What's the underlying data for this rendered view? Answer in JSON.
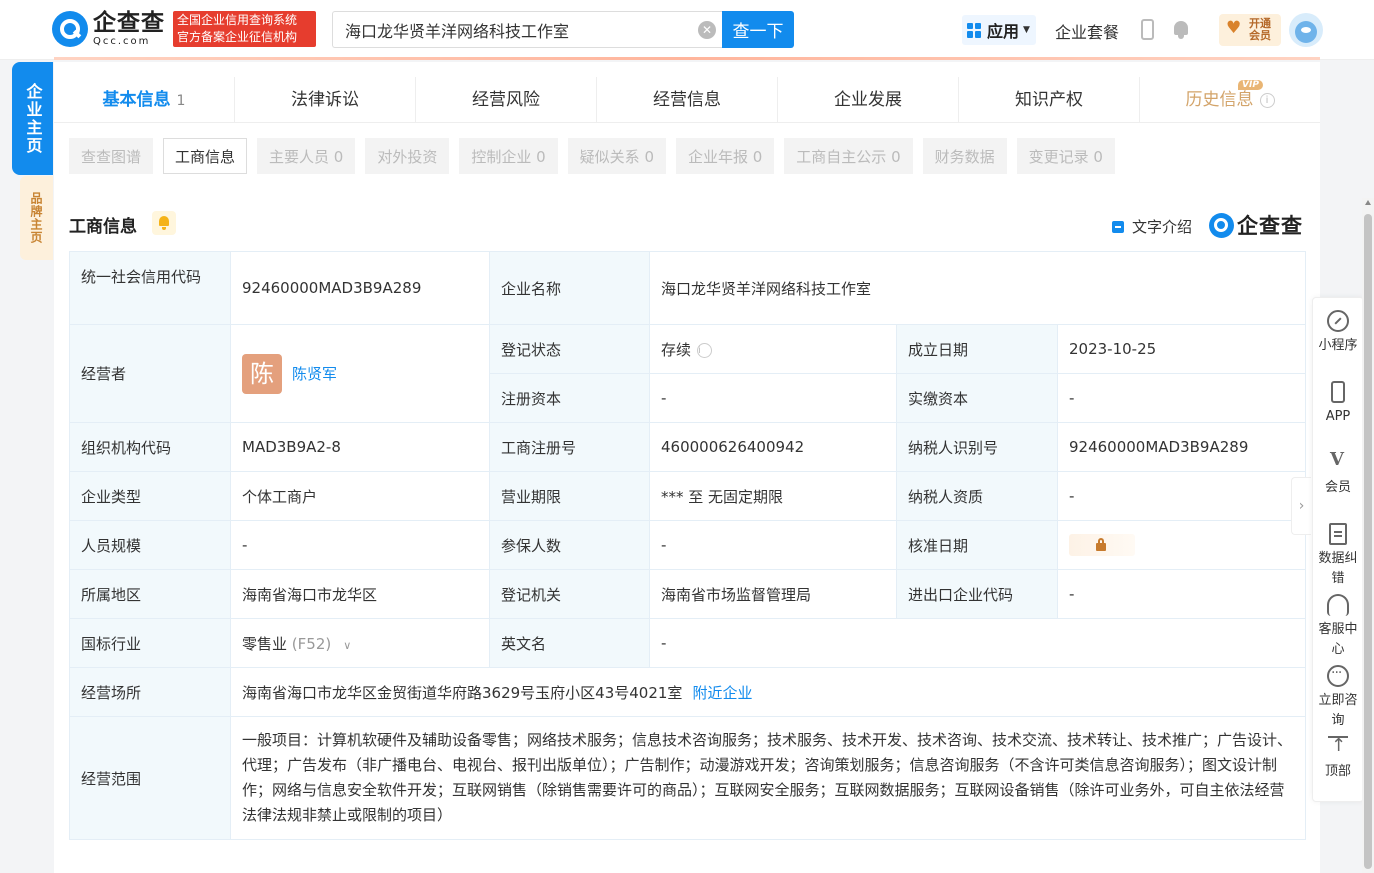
{
  "header": {
    "logo_cn": "企查查",
    "logo_en": "Qcc.com",
    "badge_line1": "全国企业信用查询系统",
    "badge_line2": "官方备案企业征信机构",
    "search_value": "海口龙华贤羊洋网络科技工作室",
    "search_button": "查一下",
    "app_label": "应用",
    "package_label": "企业套餐",
    "vip_line1": "开通",
    "vip_line2": "会员"
  },
  "side_tags": {
    "main": "企业主页",
    "brand": "品牌主页"
  },
  "tabs": [
    {
      "label": "基本信息",
      "count": "1"
    },
    {
      "label": "法律诉讼"
    },
    {
      "label": "经营风险"
    },
    {
      "label": "经营信息"
    },
    {
      "label": "企业发展"
    },
    {
      "label": "知识产权"
    },
    {
      "label": "历史信息",
      "tag": "VIP"
    }
  ],
  "chips": [
    "查查图谱",
    "工商信息",
    "主要人员 0",
    "对外投资",
    "控制企业 0",
    "疑似关系 0",
    "企业年报 0",
    "工商自主公示 0",
    "财务数据",
    "变更记录 0"
  ],
  "section": {
    "title": "工商信息",
    "text_intro": "文字介绍",
    "brand": "企查查"
  },
  "info": {
    "credit_code_label": "统一社会信用代码",
    "credit_code": "92460000MAD3B9A289",
    "company_name_label": "企业名称",
    "company_name": "海口龙华贤羊洋网络科技工作室",
    "operator_label": "经营者",
    "operator_avatar": "陈",
    "operator_name": "陈贤军",
    "status_label": "登记状态",
    "status": "存续",
    "founded_label": "成立日期",
    "founded": "2023-10-25",
    "reg_capital_label": "注册资本",
    "reg_capital": "-",
    "paid_capital_label": "实缴资本",
    "paid_capital": "-",
    "org_code_label": "组织机构代码",
    "org_code": "MAD3B9A2-8",
    "reg_no_label": "工商注册号",
    "reg_no": "460000626400942",
    "taxpayer_id_label": "纳税人识别号",
    "taxpayer_id": "92460000MAD3B9A289",
    "type_label": "企业类型",
    "type": "个体工商户",
    "term_label": "营业期限",
    "term": "*** 至 无固定期限",
    "taxpayer_qual_label": "纳税人资质",
    "taxpayer_qual": "-",
    "staff_size_label": "人员规模",
    "staff_size": "-",
    "insured_label": "参保人数",
    "insured": "-",
    "approval_date_label": "核准日期",
    "region_label": "所属地区",
    "region": "海南省海口市龙华区",
    "authority_label": "登记机关",
    "authority": "海南省市场监督管理局",
    "import_export_label": "进出口企业代码",
    "import_export": "-",
    "industry_label": "国标行业",
    "industry": "零售业",
    "industry_code": "(F52)",
    "english_name_label": "英文名",
    "english_name": "-",
    "address_label": "经营场所",
    "address": "海南省海口市龙华区金贸街道华府路3629号玉府小区43号4021室",
    "nearby_link": "附近企业",
    "scope_label": "经营范围",
    "scope": "一般项目：计算机软硬件及辅助设备零售；网络技术服务；信息技术咨询服务；技术服务、技术开发、技术咨询、技术交流、技术转让、技术推广；广告设计、代理；广告发布（非广播电台、电视台、报刊出版单位）；广告制作；动漫游戏开发；咨询策划服务；信息咨询服务（不含许可类信息咨询服务）；图文设计制作；网络与信息安全软件开发；互联网销售（除销售需要许可的商品）；互联网安全服务；互联网数据服务；互联网设备销售（除许可业务外，可自主依法经营法律法规非禁止或限制的项目）"
  },
  "right_bar": [
    {
      "label": "小程序",
      "icon": "link-icon"
    },
    {
      "label": "APP",
      "icon": "phone-icon"
    },
    {
      "label": "会员",
      "icon": "vip-icon"
    },
    {
      "label": "数据纠错",
      "icon": "edit-doc-icon"
    },
    {
      "label": "客服中心",
      "icon": "headset-icon"
    },
    {
      "label": "立即咨询",
      "icon": "chat-icon"
    },
    {
      "label": "顶部",
      "icon": "back-to-top-icon"
    }
  ]
}
